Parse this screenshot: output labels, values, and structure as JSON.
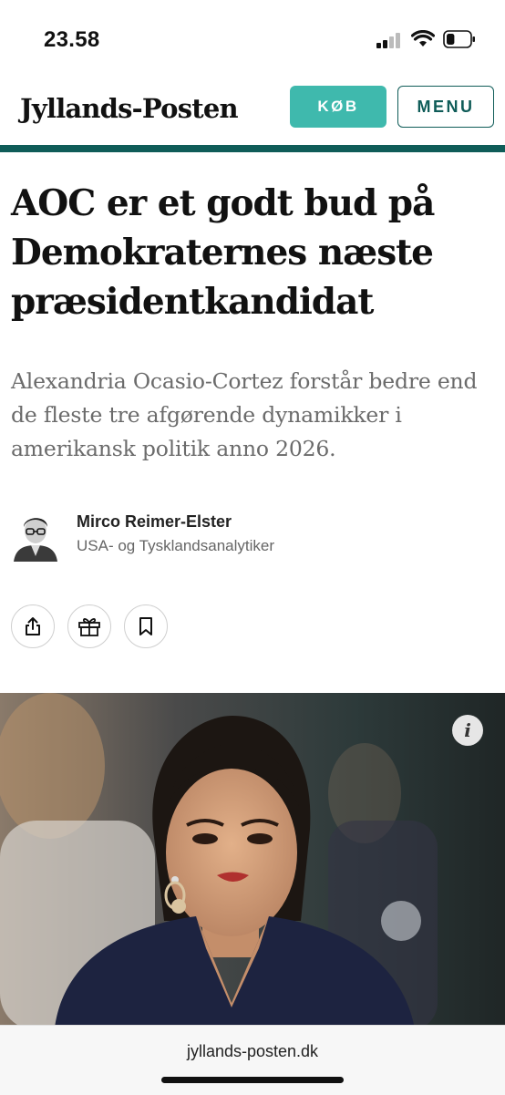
{
  "status_bar": {
    "time": "23.58",
    "battery_level": 0.35
  },
  "header": {
    "logo": "Jyllands-Posten",
    "buy_label": "KØB",
    "menu_label": "MENU"
  },
  "colors": {
    "accent": "#3fb9ad",
    "brand_dark": "#0f5c58",
    "lede": "#6b6b6b"
  },
  "article": {
    "headline": "AOC er et godt bud på Demokraternes næste præsidentkandidat",
    "lede": "Alexandria Ocasio-Cortez forstår bedre end de fleste tre afgørende dynamikker i amerikansk politik anno 2026.",
    "author_name": "Mirco Reimer-Elster",
    "author_title": "USA- og Tysklandsanalytiker"
  },
  "actions": [
    {
      "icon": "share-icon"
    },
    {
      "icon": "gift-icon"
    },
    {
      "icon": "bookmark-icon"
    }
  ],
  "hero": {
    "info_icon": "info-icon"
  },
  "browser": {
    "url": "jyllands-posten.dk"
  }
}
